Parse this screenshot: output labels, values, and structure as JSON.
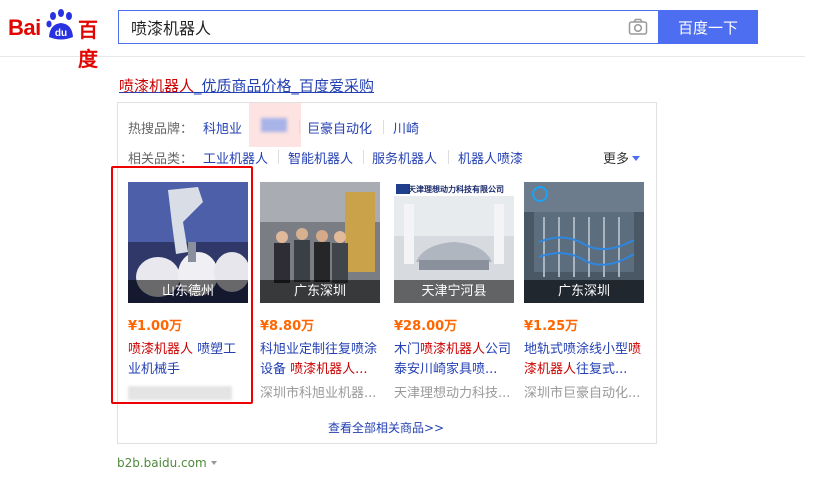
{
  "logo": {
    "latin": "Bai",
    "paw_letters": "du",
    "chinese": "百度"
  },
  "search": {
    "query": "喷漆机器人",
    "button_label": "百度一下"
  },
  "result": {
    "title_highlight": "喷漆机器人",
    "title_rest": "_优质商品价格_百度爱采购",
    "hot_brands_label": "热搜品牌：",
    "hot_brands": [
      "科旭业",
      "巨豪自动化",
      "川崎"
    ],
    "related_label": "相关品类：",
    "related": [
      "工业机器人",
      "智能机器人",
      "服务机器人",
      "机器人喷漆"
    ],
    "more_label": "更多",
    "products": [
      {
        "location": "山东德州",
        "price": "¥1.00万",
        "name_parts": [
          {
            "t": "喷漆机器人",
            "hl": true
          },
          {
            "t": " 喷塑工业机械手",
            "hl": false
          }
        ],
        "shop": ""
      },
      {
        "location": "广东深圳",
        "price": "¥8.80万",
        "name_parts": [
          {
            "t": "科旭业定制往复喷涂设备 ",
            "hl": false
          },
          {
            "t": "喷漆机器人...",
            "hl": true
          }
        ],
        "shop": "深圳市科旭业机器..."
      },
      {
        "location": "天津宁河县",
        "price": "¥28.00万",
        "name_parts": [
          {
            "t": "木门",
            "hl": false
          },
          {
            "t": "喷漆机器人",
            "hl": true
          },
          {
            "t": "公司泰安川崎家具喷...",
            "hl": false
          }
        ],
        "shop": "天津理想动力科技..."
      },
      {
        "location": "广东深圳",
        "price": "¥1.25万",
        "name_parts": [
          {
            "t": "地轨式喷涂线小型",
            "hl": false
          },
          {
            "t": "喷漆机器人",
            "hl": true
          },
          {
            "t": "往复式...",
            "hl": false
          }
        ],
        "shop": "深圳市巨豪自动化..."
      }
    ],
    "product_image_banner": "天津理想动力科技有限公司",
    "view_all": "查看全部相关商品>>",
    "domain": "b2b.baidu.com"
  },
  "colors": {
    "brand_red": "#e10602",
    "link_blue": "#2440b3",
    "price_orange": "#ff6600",
    "button_blue": "#4e6ef2"
  }
}
